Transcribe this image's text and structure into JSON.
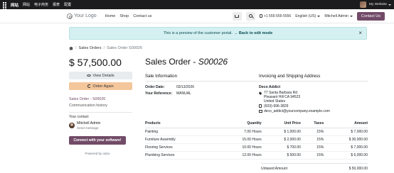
{
  "topbar": {
    "menu": [
      "网站",
      "网站",
      "电子商务",
      "报表",
      "配置"
    ],
    "site_label": "My Website"
  },
  "navbar": {
    "logo_text": "Your Logo",
    "links": [
      "Home",
      "Shop",
      "Contact us"
    ],
    "phone": "+1 555-555-5556",
    "language": "English (US)",
    "user": "Mitchell Admin",
    "contact_button": "Contact Us"
  },
  "banner": {
    "text": "This is a preview of the customer portal.",
    "edit_link": "→ Back to edit mode"
  },
  "breadcrumb": {
    "items": [
      "Sales Orders",
      "Sales Order S00026"
    ]
  },
  "sidebar": {
    "amount": "$ 57,500.00",
    "view_details": "View Details",
    "order_again": "Order Again",
    "order_link": "Sales Order - S00026",
    "history_link": "Communication history",
    "contact_title": "Your contact",
    "contact_name": "Mitchell Admin",
    "contact_message": "Send message",
    "connect_button": "Connect with your software!",
    "powered_by": "Powered by odoo"
  },
  "order": {
    "title_prefix": "Sales Order - ",
    "title_number": "S00026",
    "sale_info_title": "Sale Information",
    "order_date_label": "Order Date:",
    "order_date": "03/13/2026",
    "reference_label": "Your Reference:",
    "reference": "MANUAL",
    "invoicing_title": "Invoicing and Shipping Address",
    "company": "Deco Addict",
    "address": [
      "77 Santa Barbara Rd",
      "Pleasant Hill CA 94523",
      "United States"
    ],
    "phone": "(603)-996-3829",
    "email": "deco_addict@yourcompany.example.com"
  },
  "lines": {
    "headers": [
      "Products",
      "Quantity",
      "Unit Price",
      "Taxes",
      "Amount"
    ],
    "rows": [
      [
        "Painting",
        "7.00 Hours",
        "$ 1,000.00",
        "15%",
        "$ 7,000.00"
      ],
      [
        "Furniture Assembly",
        "15.00 Hours",
        "$ 2,000.00",
        "15%",
        "$ 30,000.00"
      ],
      [
        "Flooring Services",
        "10.00 Hours",
        "$ 700.00",
        "15%",
        "$ 7,000.00"
      ],
      [
        "Plumbing Services",
        "12.00 Hours",
        "$ 500.00",
        "15%",
        "$ 6,000.00"
      ]
    ],
    "untaxed_label": "Untaxed Amount",
    "untaxed_value": "$ 50,000.00"
  },
  "colors": {
    "brand": "#714b67",
    "banner_bg": "#d5f0f1",
    "reorder_bg": "#f4c69b"
  },
  "icons": [
    "home-icon",
    "eye-icon",
    "redo-icon",
    "cart-icon",
    "search-icon",
    "phone-icon",
    "map-pin-icon",
    "envelope-icon",
    "close-icon"
  ]
}
